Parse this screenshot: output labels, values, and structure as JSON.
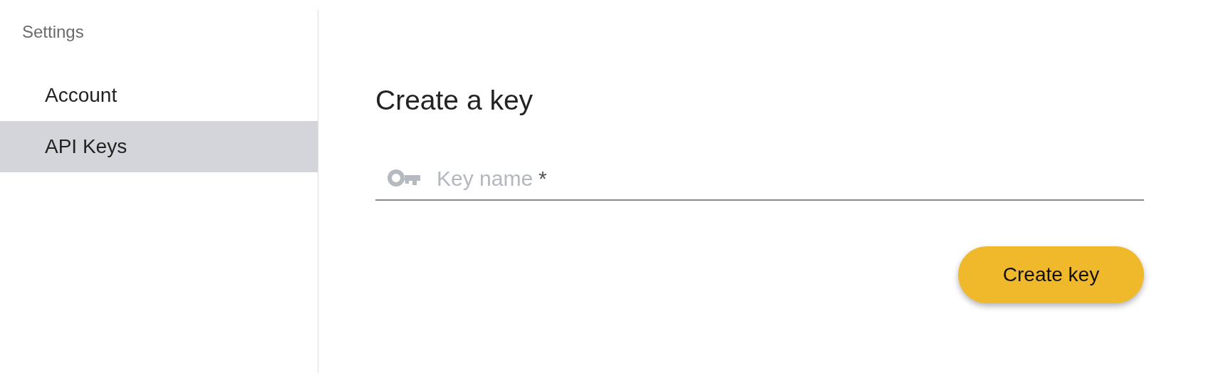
{
  "sidebar": {
    "title": "Settings",
    "items": [
      {
        "label": "Account",
        "selected": false
      },
      {
        "label": "API Keys",
        "selected": true
      }
    ]
  },
  "form": {
    "heading": "Create a key",
    "field": {
      "placeholder": "Key name",
      "required_mark": "*"
    },
    "button": "Create key"
  }
}
